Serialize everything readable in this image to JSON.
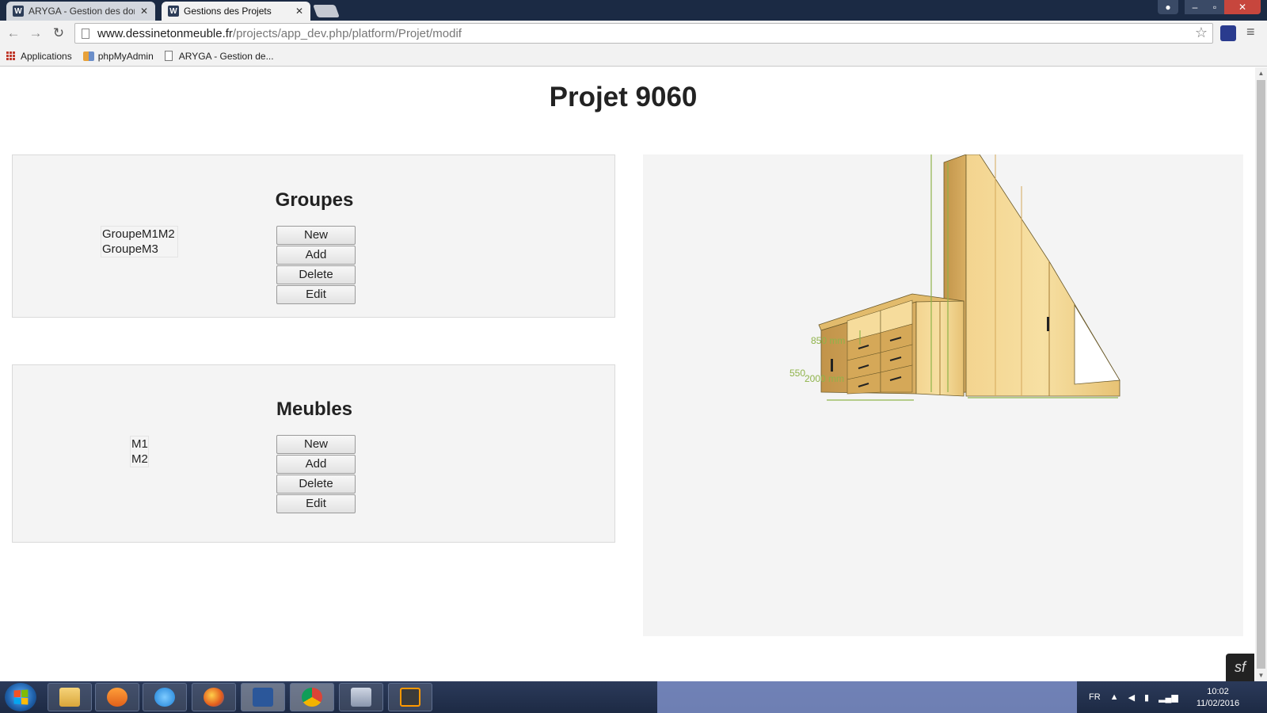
{
  "browser": {
    "tabs": [
      {
        "title": "ARYGA - Gestion des dom",
        "favicon": "W",
        "active": false
      },
      {
        "title": "Gestions des Projets",
        "favicon": "W",
        "active": true
      }
    ],
    "url_host": "www.dessinetonmeuble.fr",
    "url_path": "/projects/app_dev.php/platform/Projet/modif",
    "bookmarks": [
      "Applications",
      "phpMyAdmin",
      "ARYGA - Gestion de..."
    ]
  },
  "page": {
    "title": "Projet 9060"
  },
  "groupes": {
    "title": "Groupes",
    "items": [
      "GroupeM1M2",
      "GroupeM3"
    ],
    "buttons": {
      "new": "New",
      "add": "Add",
      "delete": "Delete",
      "edit": "Edit"
    }
  },
  "meubles": {
    "title": "Meubles",
    "items": [
      "M1",
      "M2"
    ],
    "buttons": {
      "new": "New",
      "add": "Add",
      "delete": "Delete",
      "edit": "Edit"
    }
  },
  "viewer": {
    "dimensions": [
      "850 mm",
      "550",
      "2000 mm"
    ]
  },
  "taskbar": {
    "language": "FR",
    "time": "10:02",
    "date": "11/02/2016"
  },
  "colors": {
    "wood": "#e9c57a",
    "wood_dark": "#c99a4a",
    "dimension_green": "#8fb34a"
  }
}
